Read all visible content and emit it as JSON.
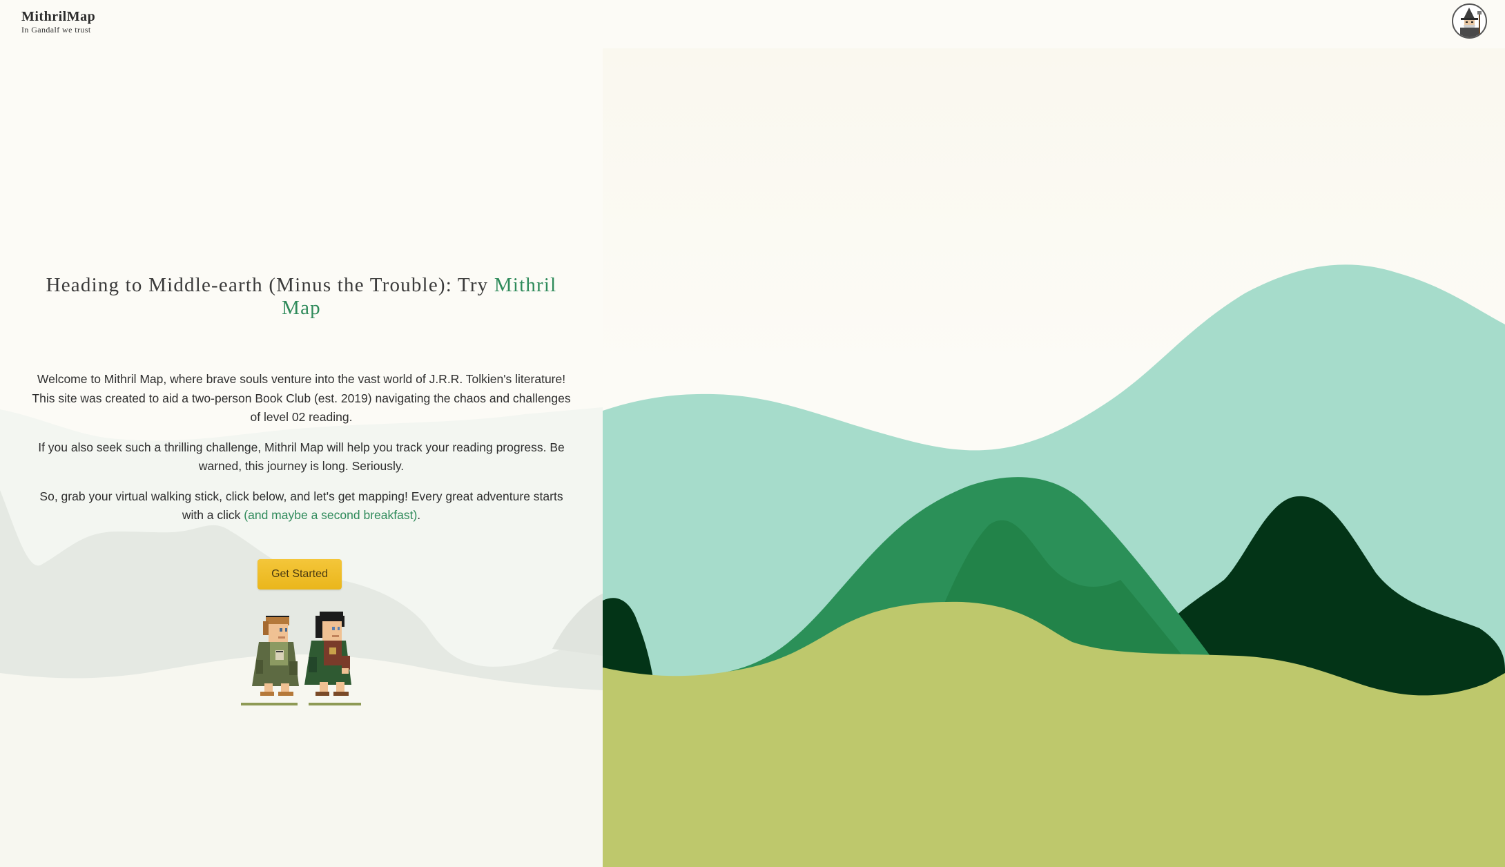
{
  "header": {
    "logo_name": "MithrilMap",
    "logo_tagline": "In Gandalf we trust",
    "avatar_icon": "wizard-avatar-icon"
  },
  "hero": {
    "title_prefix": "Heading to Middle-earth (Minus the Trouble): Try ",
    "title_accent": "Mithril Map"
  },
  "intro": {
    "paragraph1": "Welcome to Mithril Map, where brave souls venture into the vast world of J.R.R. Tolkien's literature! This site was created to aid a two-person Book Club (est. 2019) navigating the chaos and challenges of level 02 reading.",
    "paragraph2": "If you also seek such a thrilling challenge, Mithril Map will help you track your reading progress. Be warned, this journey is long. Seriously.",
    "paragraph3_prefix": "So, grab your virtual walking stick, click below, and let's get mapping! Every great adventure starts with a click ",
    "paragraph3_accent": "(and maybe a second breakfast)",
    "paragraph3_suffix": "."
  },
  "cta": {
    "label": "Get Started"
  },
  "illustration": {
    "characters_icon": "hobbit-characters-icon",
    "landscape_icon": "rolling-hills-illustration"
  },
  "colors": {
    "accent": "#2e8a5a",
    "button": "#f0bd2a",
    "mint": "#a6dccb",
    "green": "#2b9058",
    "dark_green": "#033417",
    "olive": "#bec86c",
    "background": "#fcfbf6"
  }
}
